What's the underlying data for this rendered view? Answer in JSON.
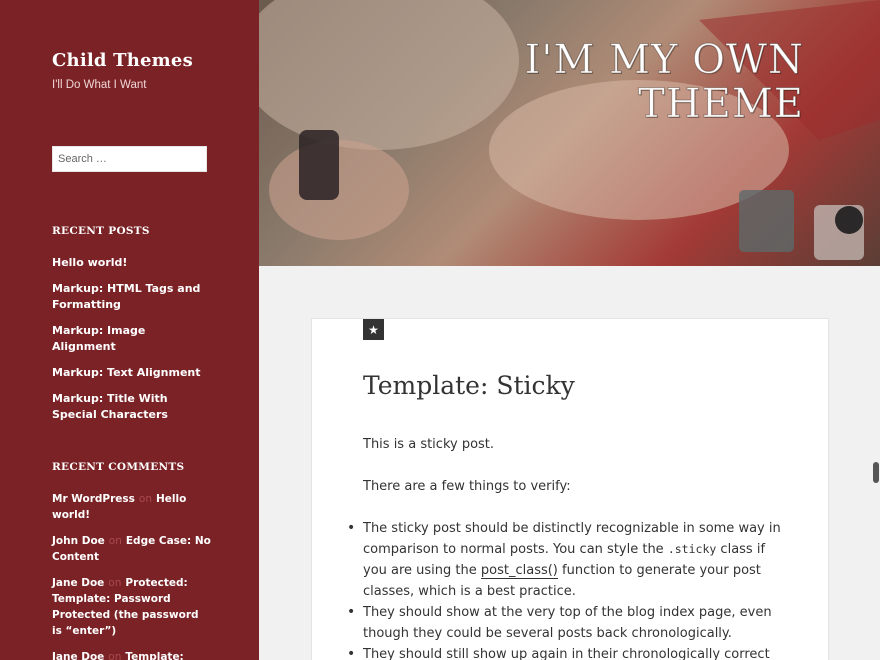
{
  "site": {
    "title": "Child Themes",
    "tagline": "I'll Do What I Want"
  },
  "search": {
    "placeholder": "Search …"
  },
  "recent_posts": {
    "heading": "RECENT POSTS",
    "items": [
      {
        "label": "Hello world!"
      },
      {
        "label": "Markup: HTML Tags and Formatting"
      },
      {
        "label": "Markup: Image Alignment"
      },
      {
        "label": "Markup: Text Alignment"
      },
      {
        "label": "Markup: Title With Special Characters"
      }
    ]
  },
  "recent_comments": {
    "heading": "RECENT COMMENTS",
    "on_word": "on",
    "items": [
      {
        "author": "Mr WordPress",
        "target": "Hello world!"
      },
      {
        "author": "John Doe",
        "target": "Edge Case: No Content"
      },
      {
        "author": "Jane Doe",
        "target": "Protected: Template: Password Protected (the password is “enter”)"
      },
      {
        "author": "Jane Doe",
        "target": "Template: Comments"
      }
    ]
  },
  "header": {
    "title_line1": "I'M MY OWN",
    "title_line2": "THEME"
  },
  "post": {
    "sticky_icon": "star-icon",
    "title": "Template: Sticky",
    "intro": "This is a sticky post.",
    "verify": "There are a few things to verify:",
    "bullets": [
      {
        "pre": "The sticky post should be distinctly recognizable in some way in comparison to normal posts. You can style the ",
        "code": ".sticky",
        "mid": " class if you are using the ",
        "link": "post_class()",
        "post": " function to generate your post classes, which is a best practice."
      },
      {
        "text": "They should show at the very top of the blog index page, even though they could be several posts back chronologically."
      },
      {
        "text": "They should still show up again in their chronologically correct"
      }
    ]
  },
  "colors": {
    "sidebar_bg": "#7a2225",
    "content_bg": "#ffffff",
    "page_bg": "#f1f1f1",
    "text": "#333333"
  }
}
